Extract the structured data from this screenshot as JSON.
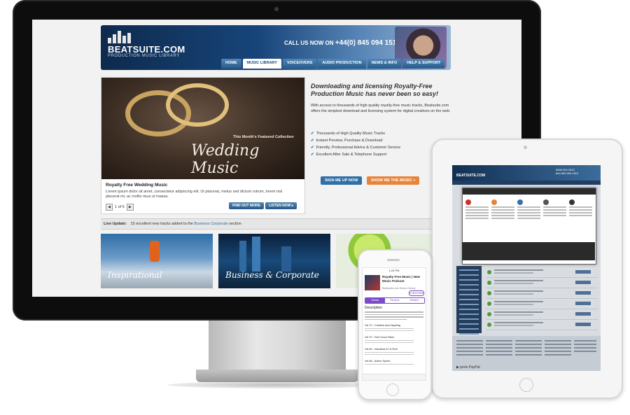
{
  "site": {
    "logo": "BEATSUITE.COM",
    "logo_sub": "PRODUCTION MUSIC LIBRARY",
    "call_text": "CALL US NOW ON",
    "phone": "+44(0) 845 094 1512",
    "nav": [
      "HOME",
      "MUSIC LIBRARY",
      "VOICEOVERS",
      "AUDIO PRODUCTION",
      "NEWS & INFO",
      "HELP & SUPPORT"
    ],
    "featured": {
      "kicker": "This Month's Featured Collection",
      "title": "Wedding Music",
      "heading": "Royalty Free Wedding Music",
      "text": "Lorem ipsum dolor sit amet, consectetur adipiscing elit. Ut placerat, metus sed dictum rutrum, lorem nisl placerat mi, ac mollis risus ut massa.",
      "pager": "1 of 6",
      "prev": "◀",
      "next": "▶",
      "btn_find": "FIND OUT MORE",
      "btn_listen": "LISTEN NOW ▸"
    },
    "intro": {
      "heading": "Downloading and licensing Royalty-Free Production Music has never been so easy!",
      "text": "With access to thousands of high quality royalty-free music tracks, Beatsuite.com offers the simplest download and licensing system for digital creatives on the web.",
      "checks": [
        "Thousands of High Quality Music Tracks",
        "Instant Preview, Purchase & Download",
        "Friendly, Professional Advice & Customer Service",
        "Excellent After Sale & Telephone Support"
      ],
      "check_glyph": "✔",
      "cta_signup": "SIGN ME UP NOW",
      "cta_music": "SHOW ME THE MUSIC »"
    },
    "live_label": "Live Update:",
    "live_text": "15 excellent new tracks added to the",
    "live_link": "Business Corporate",
    "live_suffix": "section",
    "tiles": [
      "Inspirational",
      "Business & Corporate",
      ""
    ]
  },
  "imac": {
    "apple_logo": ""
  },
  "ipad": {
    "phone_uk": "0845 094 1512",
    "phone_usa": "844 845 094 1512",
    "payment": "▶ protx  PayPal"
  },
  "iphone": {
    "status": "1:20 PM",
    "title": "Royalty Free Music | New Music Podcast",
    "subtitle": "Beatsuite.com Music Library",
    "get": "SUBSCRIBE",
    "tabs": [
      "Details",
      "Reviews",
      "Related"
    ],
    "description_label": "Description",
    "items": [
      "Vol.70 - Creative and Inspiring",
      "Vol.70 - Feel Good Vibes",
      "Vol.69 - Industrial & Hi-Tech",
      "Vol.68 - Action Sports"
    ]
  },
  "colors": {
    "accent_blue": "#2a5a88",
    "accent_orange": "#e8843a",
    "cta_blue": "#2e6fa6"
  }
}
